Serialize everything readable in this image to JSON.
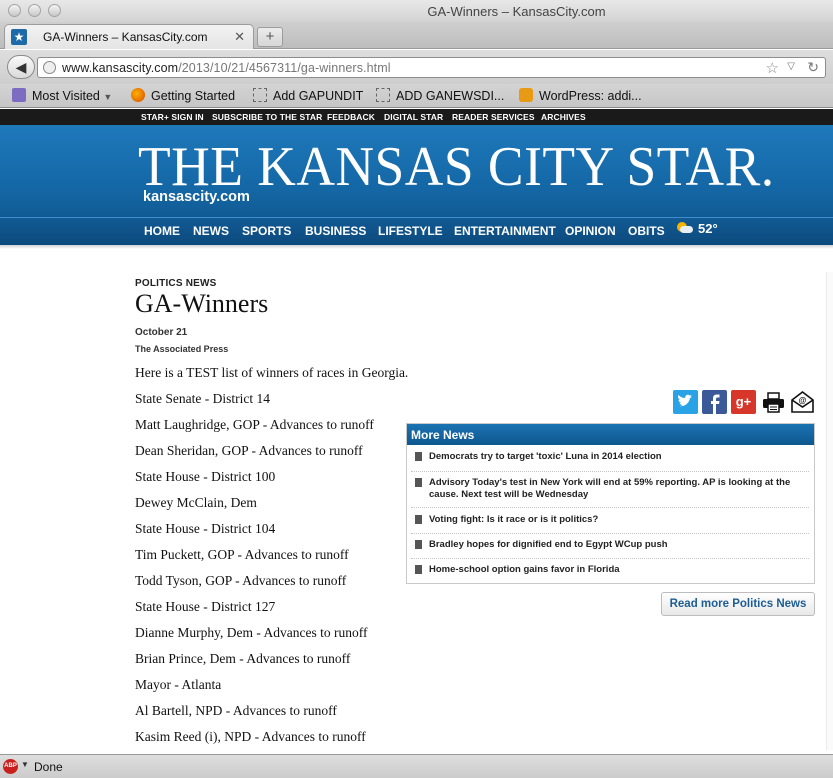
{
  "browser": {
    "window_title": "GA-Winners – KansasCity.com",
    "tab_title": "GA-Winners – KansasCity.com",
    "url_prefix": "www.kansascity.com",
    "url_path": "/2013/10/21/4567311/ga-winners.html",
    "bookmarks": [
      "Most Visited",
      "Getting Started",
      "Add GAPUNDIT",
      "ADD GANEWSDI...",
      "WordPress: addi..."
    ],
    "status": "Done",
    "abp_label": "ABP"
  },
  "site": {
    "utility_links": [
      "STAR+ SIGN IN",
      "SUBSCRIBE TO THE STAR",
      "FEEDBACK",
      "DIGITAL STAR",
      "READER SERVICES",
      "ARCHIVES"
    ],
    "title": "THE KANSAS CITY STAR.",
    "subtitle": "kansascity.com",
    "nav": [
      "HOME",
      "NEWS",
      "SPORTS",
      "BUSINESS",
      "LIFESTYLE",
      "ENTERTAINMENT",
      "OPINION",
      "OBITS"
    ],
    "weather": "52°",
    "accent_color": "#1466a4"
  },
  "article": {
    "kicker": "POLITICS NEWS",
    "headline": "GA-Winners",
    "date": "October 21",
    "byline": "The Associated Press",
    "paragraphs": [
      "Here is a TEST list of winners of races in Georgia.",
      "State Senate - District 14",
      "Matt Laughridge, GOP - Advances to runoff",
      "Dean Sheridan, GOP - Advances to runoff",
      "State House - District 100",
      "Dewey McClain, Dem",
      "State House - District 104",
      "Tim Puckett, GOP - Advances to runoff",
      "Todd Tyson, GOP - Advances to runoff",
      "State House - District 127",
      "Dianne Murphy, Dem - Advances to runoff",
      "Brian Prince, Dem - Advances to runoff",
      "Mayor - Atlanta",
      "Al Bartell, NPD - Advances to runoff",
      "Kasim Reed (i), NPD - Advances to runoff"
    ]
  },
  "more_news": {
    "heading": "More News",
    "items": [
      "Democrats try to target 'toxic' Luna in 2014 election",
      "Advisory Today's test in New York will end at 59% reporting. AP is looking at the cause. Next test will be Wednesday",
      "Voting fight: Is it race or is it politics?",
      "Bradley hopes for dignified end to Egypt WCup push",
      "Home-school option gains favor in Florida"
    ],
    "read_more": "Read more Politics News"
  },
  "share_icons": [
    "twitter-icon",
    "facebook-icon",
    "google-plus-icon",
    "print-icon",
    "email-icon"
  ],
  "share_google_label": "g+"
}
